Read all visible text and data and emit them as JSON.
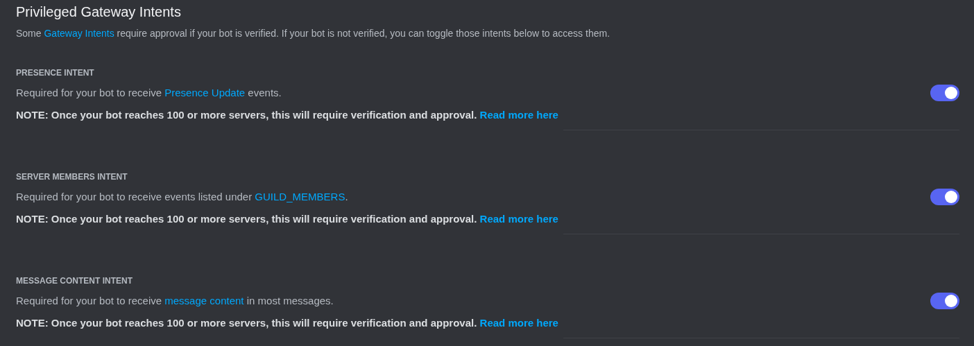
{
  "title": "Privileged Gateway Intents",
  "intro": {
    "before": "Some ",
    "link": "Gateway Intents",
    "after": " require approval if your bot is verified. If your bot is not verified, you can toggle those intents below to access them."
  },
  "intents": [
    {
      "label": "PRESENCE INTENT",
      "before": "Required for your bot to receive ",
      "link": "Presence Update",
      "after": " events.",
      "on": true,
      "note": "NOTE: Once your bot reaches 100 or more servers, this will require verification and approval.",
      "note_link": "Read more here"
    },
    {
      "label": "SERVER MEMBERS INTENT",
      "before": "Required for your bot to receive events listed under ",
      "link": "GUILD_MEMBERS",
      "after": ".",
      "on": true,
      "note": "NOTE: Once your bot reaches 100 or more servers, this will require verification and approval.",
      "note_link": "Read more here"
    },
    {
      "label": "MESSAGE CONTENT INTENT",
      "before": "Required for your bot to receive ",
      "link": "message content",
      "after": " in most messages.",
      "on": true,
      "note": "NOTE: Once your bot reaches 100 or more servers, this will require verification and approval.",
      "note_link": "Read more here"
    }
  ]
}
